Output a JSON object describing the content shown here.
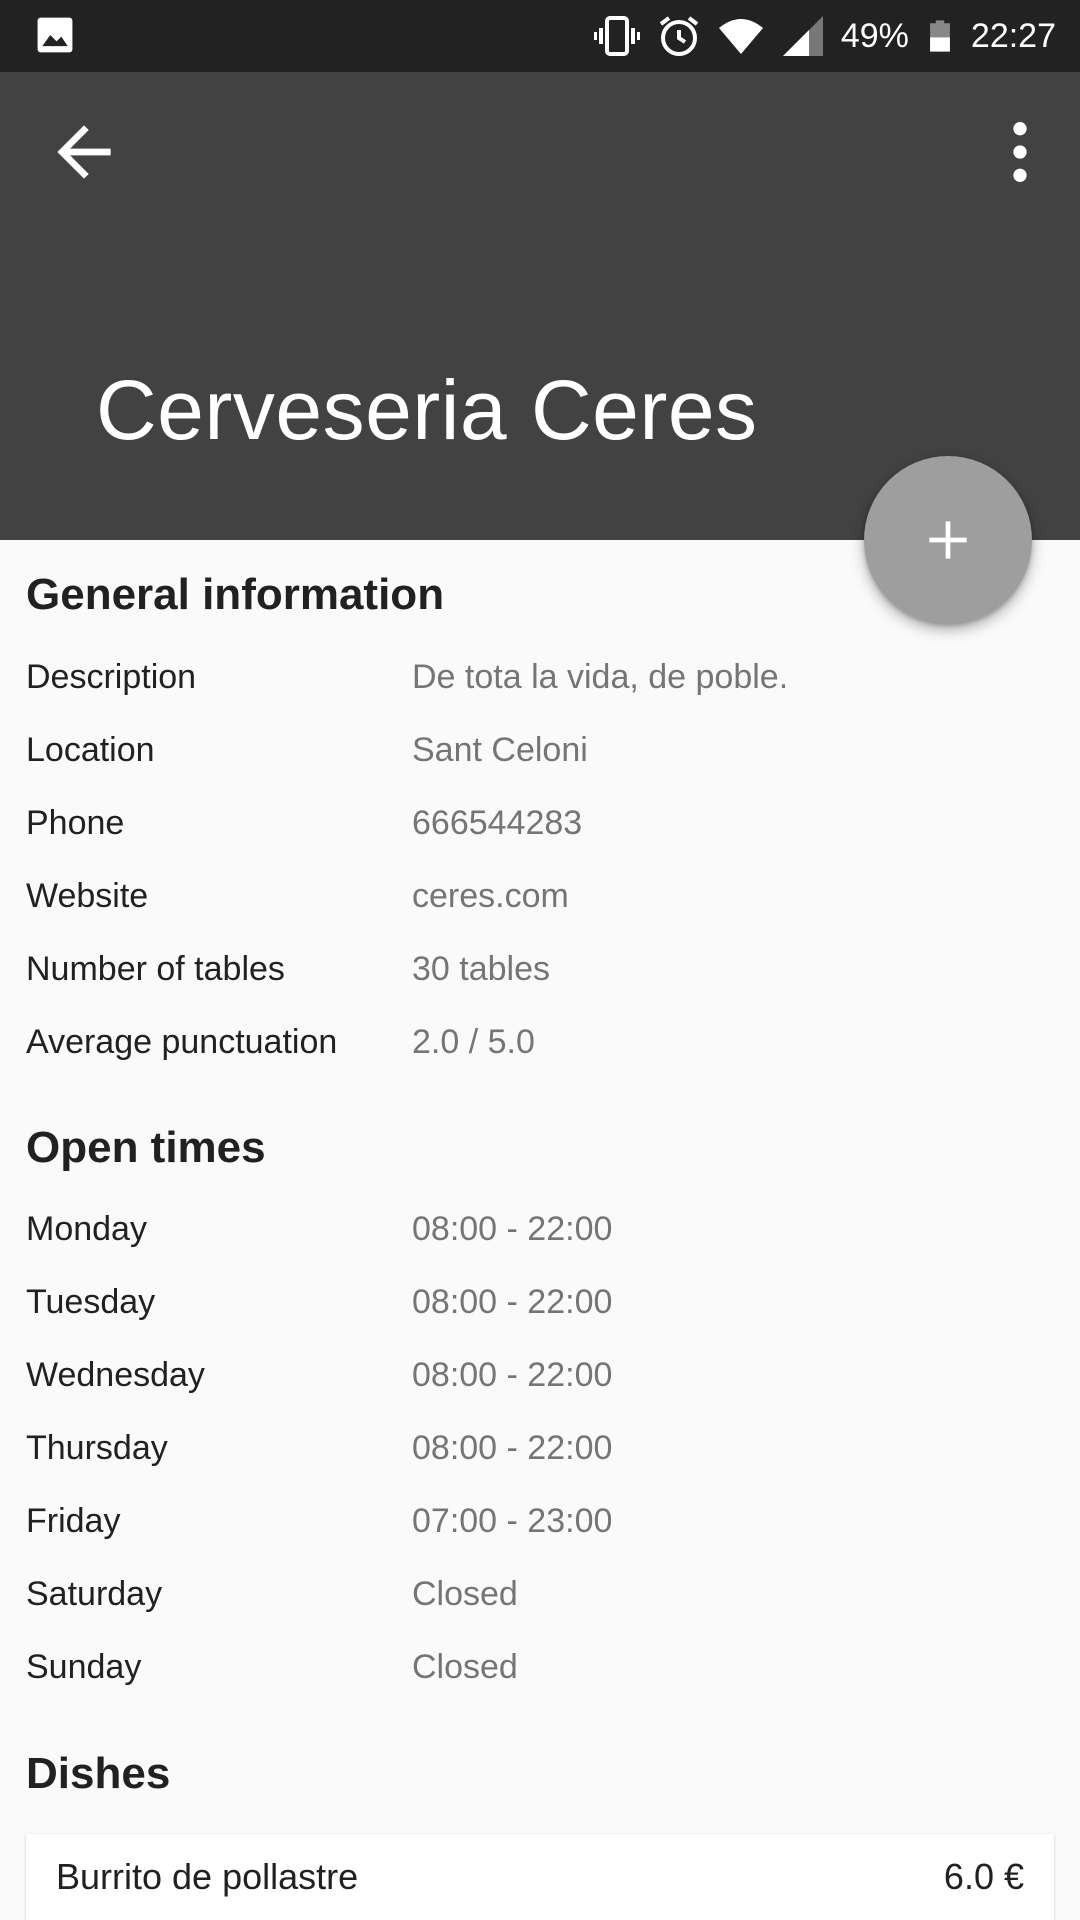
{
  "status_bar": {
    "left_icon": "image-icon",
    "icons": [
      "vibrate-icon",
      "alarm-icon",
      "wifi-icon",
      "signal-icon"
    ],
    "battery": "49%",
    "battery_icon": "battery-icon",
    "time": "22:27"
  },
  "app_bar": {
    "title": "Cerveseria Ceres",
    "back_icon": "arrow-back-icon",
    "more_icon": "more-vert-icon"
  },
  "fab": {
    "icon": "plus-icon"
  },
  "general": {
    "title": "General information",
    "rows": [
      {
        "label": "Description",
        "value": "De tota la vida, de poble."
      },
      {
        "label": "Location",
        "value": "Sant Celoni"
      },
      {
        "label": "Phone",
        "value": "666544283"
      },
      {
        "label": "Website",
        "value": "ceres.com"
      },
      {
        "label": "Number of tables",
        "value": "30 tables"
      },
      {
        "label": "Average punctuation",
        "value": "2.0 / 5.0"
      }
    ]
  },
  "open_times": {
    "title": "Open times",
    "rows": [
      {
        "label": "Monday",
        "value": "08:00 - 22:00"
      },
      {
        "label": "Tuesday",
        "value": "08:00 - 22:00"
      },
      {
        "label": "Wednesday",
        "value": "08:00 - 22:00"
      },
      {
        "label": "Thursday",
        "value": "08:00 - 22:00"
      },
      {
        "label": "Friday",
        "value": "07:00 - 23:00"
      },
      {
        "label": "Saturday",
        "value": "Closed"
      },
      {
        "label": "Sunday",
        "value": "Closed"
      }
    ]
  },
  "dishes": {
    "title": "Dishes",
    "items": [
      {
        "name": "Burrito de pollastre",
        "price": "6.0 €"
      }
    ]
  },
  "colors": {
    "status_bar": "#222222",
    "app_bar": "#424242",
    "fab": "#9e9e9e",
    "background": "#fafafa",
    "label_text": "#212121",
    "value_text": "#757575"
  }
}
